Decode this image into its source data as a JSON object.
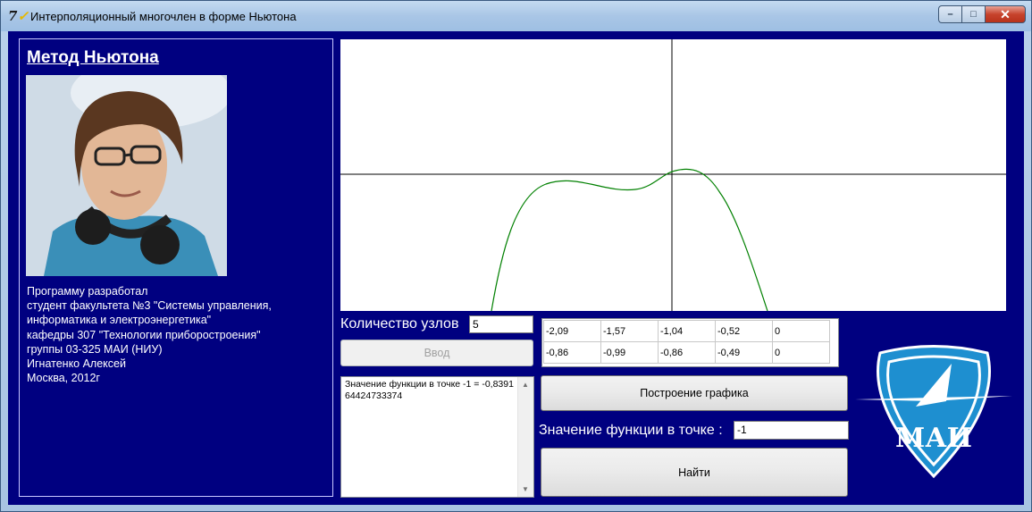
{
  "window": {
    "title": "Интерполяционный многочлен в форме Ньютона",
    "icon": "app-icon",
    "controls": {
      "minimize": "–",
      "maximize": "□",
      "close": "✕"
    }
  },
  "info": {
    "heading": "Метод Ньютона",
    "lines": [
      "Программу разработал",
      "студент факультета №3 \"Системы управления,",
      "информатика и электроэнергетика\"",
      "кафедры 307 \"Технологии приборостроения\"",
      "группы 03-325 МАИ (НИУ)",
      "Игнатенко Алексей",
      "Москва, 2012г"
    ]
  },
  "nodes": {
    "label": "Количество узлов",
    "value": "5",
    "enter_button": "Ввод"
  },
  "table": {
    "x": [
      "-2,09",
      "-1,57",
      "-1,04",
      "-0,52",
      "0"
    ],
    "y": [
      "-0,86",
      "-0,99",
      "-0,86",
      "-0,49",
      "0"
    ]
  },
  "result": {
    "text": "Значение функции в точке -1 = -0,839164424733374"
  },
  "actions": {
    "plot_button": "Построение графика",
    "point_label": "Значение функции в точке :",
    "point_value": "-1",
    "find_button": "Найти"
  },
  "logo": {
    "text": "МАИ"
  },
  "colors": {
    "client_bg": "#000080",
    "curve": "#008000",
    "axes": "#000000"
  }
}
